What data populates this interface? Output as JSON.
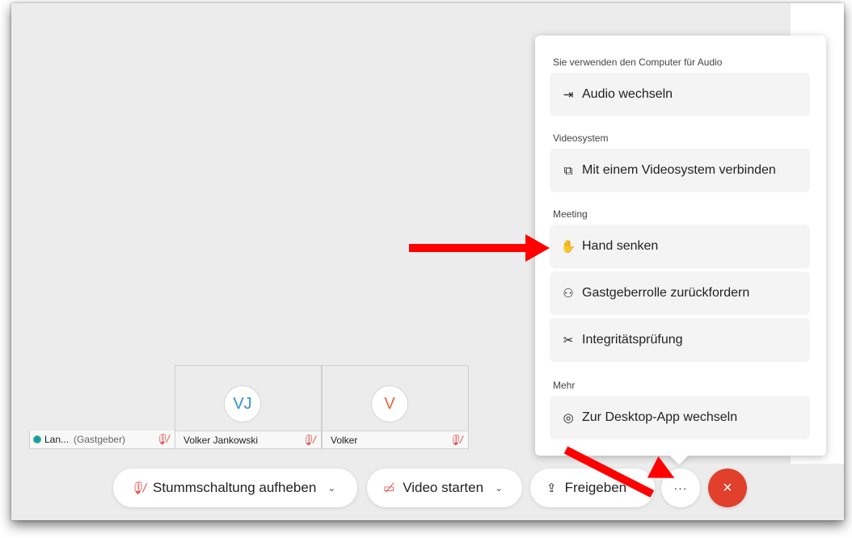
{
  "menu": {
    "sections": [
      {
        "label": "Sie verwenden den Computer für Audio",
        "items": [
          {
            "label": "Audio wechseln",
            "icon": "audio-switch-icon"
          }
        ]
      },
      {
        "label": "Videosystem",
        "items": [
          {
            "label": "Mit einem Videosystem verbinden",
            "icon": "cast-icon"
          }
        ]
      },
      {
        "label": "Meeting",
        "items": [
          {
            "label": "Hand senken",
            "icon": "raised-hand-icon"
          },
          {
            "label": "Gastgeberrolle zurückfordern",
            "icon": "person-icon"
          },
          {
            "label": "Integritätsprüfung",
            "icon": "tools-icon"
          }
        ]
      },
      {
        "label": "Mehr",
        "items": [
          {
            "label": "Zur Desktop-App wechseln",
            "icon": "desktop-app-icon"
          }
        ]
      }
    ]
  },
  "participants": [
    {
      "name": "Lan...",
      "role": "(Gastgeber)"
    },
    {
      "name": "Volker Jankowski",
      "initials": "VJ",
      "avatar_color": "#2f8fd6"
    },
    {
      "name": "Volker",
      "initials": "V",
      "avatar_color": "#e8643c"
    }
  ],
  "toolbar": {
    "mute_label": "Stummschaltung aufheben",
    "video_label": "Video starten",
    "share_label": "Freigeben",
    "more_label": "···",
    "end_label": "×"
  },
  "colors": {
    "end_call": "#e1402d",
    "mute_icon": "#d9534f",
    "annotation_arrow": "#ff0000"
  }
}
